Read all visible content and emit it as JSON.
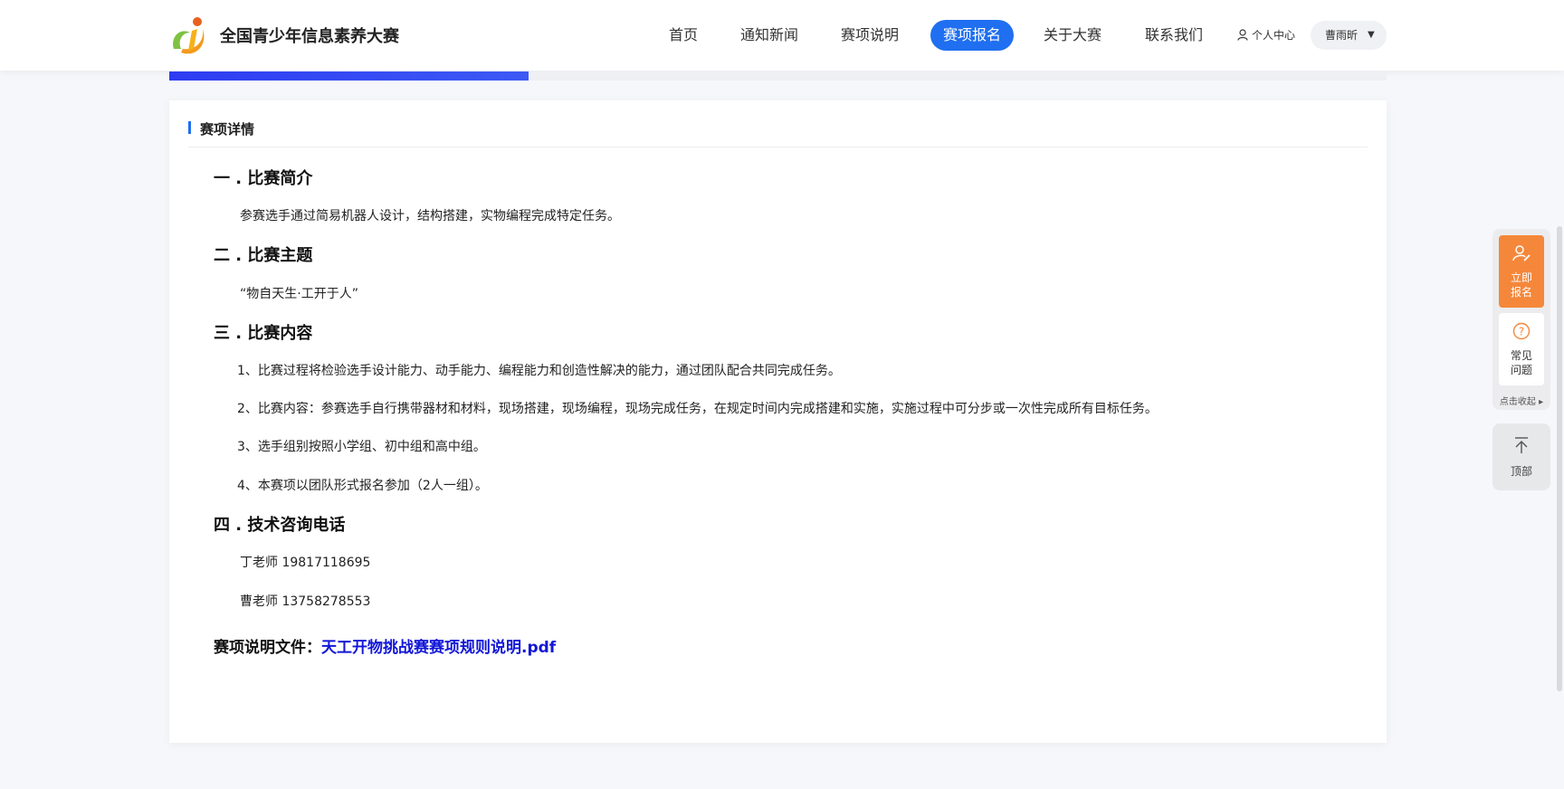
{
  "header": {
    "site_title": "全国青少年信息素养大赛",
    "nav": [
      {
        "label": "首页",
        "active": false
      },
      {
        "label": "通知新闻",
        "active": false
      },
      {
        "label": "赛项说明",
        "active": false
      },
      {
        "label": "赛项报名",
        "active": true
      },
      {
        "label": "关于大赛",
        "active": false
      },
      {
        "label": "联系我们",
        "active": false
      }
    ],
    "user_center": "个人中心",
    "user_name": "曹雨昕",
    "accent_color": "#1f6ff0"
  },
  "progress": {
    "fraction": 0.295
  },
  "detail": {
    "section_title": "赛项详情",
    "s1_heading": "一 . 比赛简介",
    "s1_text": "参赛选手通过简易机器人设计，结构搭建，实物编程完成特定任务。",
    "s2_heading": "二 . 比赛主题",
    "s2_text": "“物自天生·工开于人”",
    "s3_heading": "三 . 比赛内容",
    "s3_items": [
      "1、比赛过程将检验选手设计能力、动手能力、编程能力和创造性解决的能力，通过团队配合共同完成任务。",
      "2、比赛内容：参赛选手自行携带器材和材料，现场搭建，现场编程，现场完成任务，在规定时间内完成搭建和实施，实施过程中可分步或一次性完成所有目标任务。",
      "3、选手组别按照小学组、初中组和高中组。",
      "4、本赛项以团队形式报名参加（2人一组）。"
    ],
    "s4_heading": "四 . 技术咨询电话",
    "contacts": [
      "丁老师 19817118695",
      "曹老师 13758278553"
    ],
    "file_label": "赛项说明文件：",
    "file_name": "天工开物挑战赛赛项规则说明.pdf"
  },
  "float_panel": {
    "signup_l1": "立即",
    "signup_l2": "报名",
    "faq_l1": "常见",
    "faq_l2": "问题",
    "collapse": "点击收起",
    "top": "顶部",
    "signup_color": "#f5873a"
  }
}
